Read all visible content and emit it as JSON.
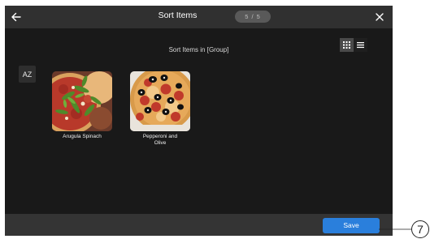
{
  "header": {
    "title": "Sort Items",
    "pager": "5 / 5",
    "back_icon": "arrow-left-icon",
    "close_icon": "close-icon"
  },
  "main": {
    "subtitle": "Sort Items in [Group]",
    "sort_button_label": "AZ",
    "view_toggle": {
      "options": [
        "grid",
        "list"
      ],
      "selected": "grid"
    },
    "items": [
      {
        "label": "Arugula Spinach",
        "image": "arugula-spinach-pizza-image"
      },
      {
        "label": "Pepperoni and Olive",
        "image": "pepperoni-olive-pizza-image"
      }
    ]
  },
  "footer": {
    "save_label": "Save"
  },
  "annotation": {
    "number": "7"
  },
  "colors": {
    "background": "#191919",
    "bar": "#303030",
    "accent": "#2a7fdc"
  }
}
